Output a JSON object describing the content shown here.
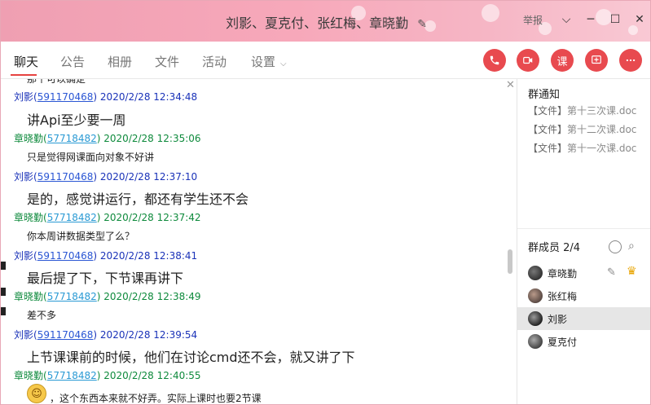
{
  "window": {
    "title": "刘影、夏克付、张红梅、章晓勤",
    "report_label": "举报",
    "title_edit_icon": "edit-icon",
    "controls": [
      "chevron-down-icon",
      "minimize-icon",
      "maximize-icon",
      "close-icon"
    ]
  },
  "tabs": [
    {
      "label": "聊天",
      "active": true
    },
    {
      "label": "公告"
    },
    {
      "label": "相册"
    },
    {
      "label": "文件"
    },
    {
      "label": "活动"
    },
    {
      "label": "设置"
    }
  ],
  "actions": {
    "call_icon": "phone-icon",
    "video_icon": "video-call-icon",
    "class_label": "课",
    "add_icon": "add-message-icon",
    "more_icon": "more-icon"
  },
  "chat": {
    "clipped_text": "那个可以确定",
    "messages": [
      {
        "name": "刘影",
        "uid": "591170468",
        "time": "2020/2/28 12:34:48",
        "text": "讲Api至少要一周"
      },
      {
        "name": "章晓勤",
        "uid": "57718482",
        "time": "2020/2/28 12:35:06",
        "text": "只是觉得网课面向对象不好讲"
      },
      {
        "name": "刘影",
        "uid": "591170468",
        "time": "2020/2/28 12:37:10",
        "text": "是的，感觉讲运行，都还有学生还不会"
      },
      {
        "name": "章晓勤",
        "uid": "57718482",
        "time": "2020/2/28 12:37:42",
        "text": "你本周讲数据类型了么？"
      },
      {
        "name": "刘影",
        "uid": "591170468",
        "time": "2020/2/28 12:38:41",
        "text": "最后提了下，下节课再讲下"
      },
      {
        "name": "章晓勤",
        "uid": "57718482",
        "time": "2020/2/28 12:38:49",
        "text": "差不多"
      },
      {
        "name": "刘影",
        "uid": "591170468",
        "time": "2020/2/28 12:39:54",
        "text": "上节课课前的时候，他们在讨论cmd还不会，就又讲了下"
      },
      {
        "name": "章晓勤",
        "uid": "57718482",
        "time": "2020/2/28 12:40:55",
        "text": "，这个东西本来就不好弄。实际上课时也要2节课"
      }
    ]
  },
  "side": {
    "notice_title": "群通知",
    "files": [
      {
        "tag": "【文件】",
        "name": "第十三次课.doc"
      },
      {
        "tag": "【文件】",
        "name": "第十二次课.doc"
      },
      {
        "tag": "【文件】",
        "name": "第十一次课.doc"
      }
    ],
    "members_title": "群成员 2/4",
    "members": [
      {
        "name": "章晓勤"
      },
      {
        "name": "张红梅"
      },
      {
        "name": "刘影",
        "selected": true
      },
      {
        "name": "夏克付"
      }
    ]
  }
}
